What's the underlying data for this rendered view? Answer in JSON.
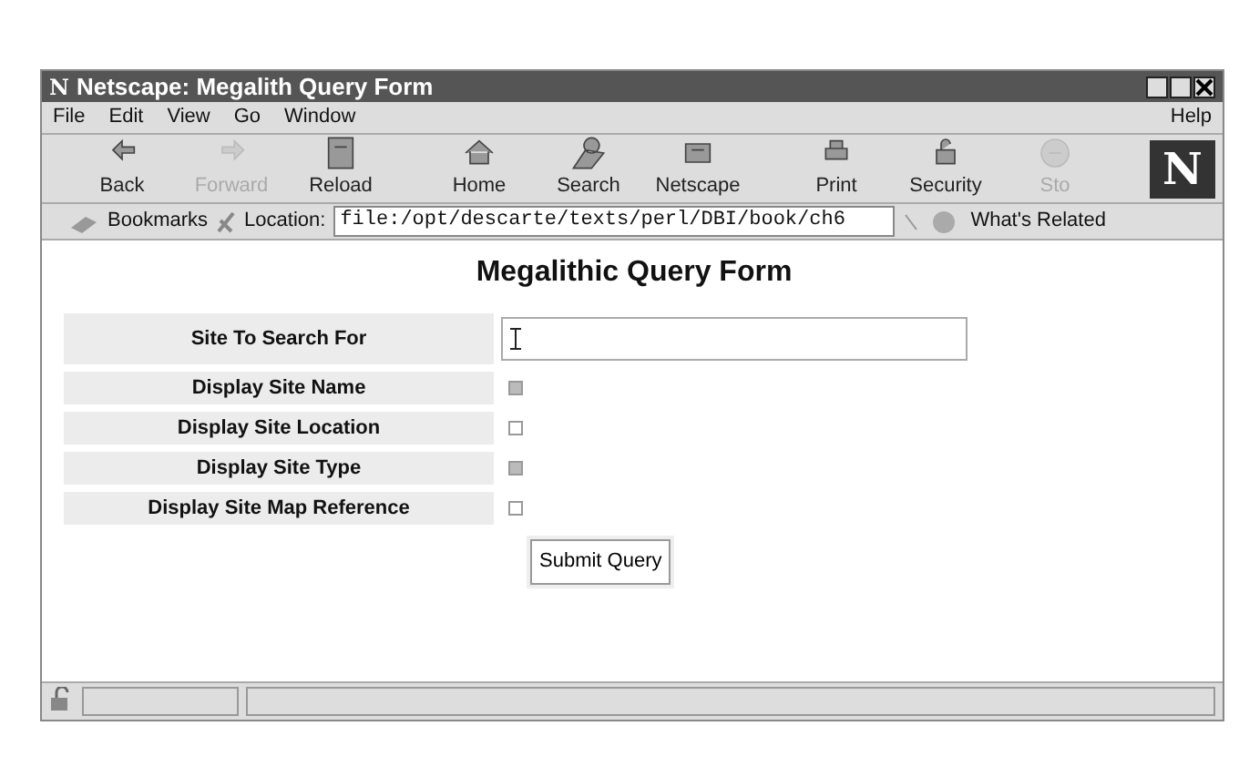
{
  "window": {
    "logo": "N",
    "title": "Netscape: Megalith Query Form"
  },
  "menu": {
    "items": [
      "File",
      "Edit",
      "View",
      "Go",
      "Window"
    ],
    "help": "Help"
  },
  "toolbar": [
    {
      "label": "Back",
      "disabled": false
    },
    {
      "label": "Forward",
      "disabled": true
    },
    {
      "label": "Reload",
      "disabled": false
    },
    {
      "label": "Home",
      "disabled": false
    },
    {
      "label": "Search",
      "disabled": false
    },
    {
      "label": "Netscape",
      "disabled": false
    },
    {
      "label": "Print",
      "disabled": false
    },
    {
      "label": "Security",
      "disabled": false
    },
    {
      "label": "Sto",
      "disabled": true
    }
  ],
  "toolbar_logo": "N",
  "location_bar": {
    "bookmarks": "Bookmarks",
    "location_label": "Location:",
    "url": "file:/opt/descarte/texts/perl/DBI/book/ch6",
    "related": "What's Related"
  },
  "page": {
    "heading": "Megalithic Query Form",
    "search_label": "Site To Search For",
    "options": [
      {
        "label": "Display Site Name",
        "checked": true
      },
      {
        "label": "Display Site Location",
        "checked": false
      },
      {
        "label": "Display Site Type",
        "checked": true
      },
      {
        "label": "Display Site Map Reference",
        "checked": false
      }
    ],
    "submit": "Submit Query"
  }
}
